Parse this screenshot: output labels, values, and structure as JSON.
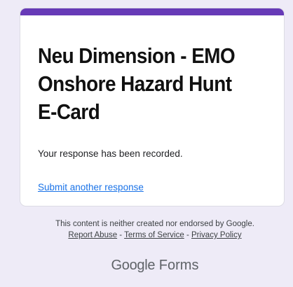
{
  "form": {
    "title": "Neu Dimension - EMO Onshore Hazard Hunt E-Card",
    "confirmation": "Your response has been recorded.",
    "submit_another": "Submit another response"
  },
  "footer": {
    "disclaimer": "This content is neither created nor endorsed by Google.",
    "report_abuse": "Report Abuse",
    "terms": "Terms of Service",
    "privacy": "Privacy Policy",
    "separator": " - "
  },
  "brand": {
    "google": "Google",
    "forms": "Forms"
  },
  "colors": {
    "accent": "#673ab7",
    "background": "#eeebf7",
    "link": "#1a73e8"
  }
}
